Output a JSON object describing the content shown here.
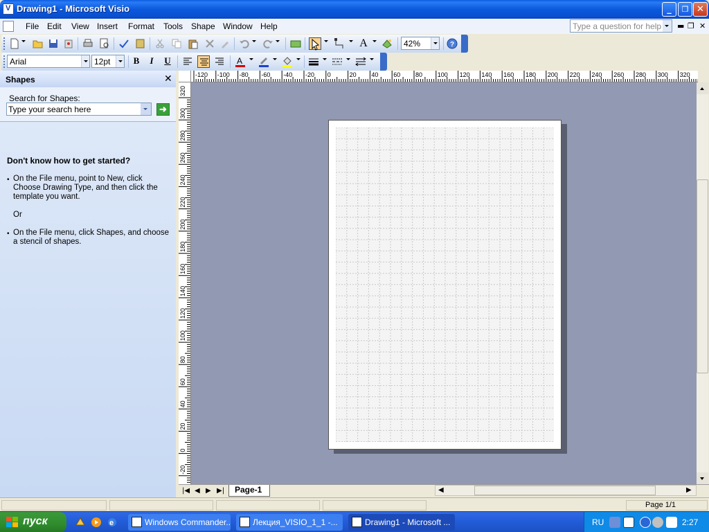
{
  "window": {
    "title": "Drawing1 - Microsoft Visio"
  },
  "menu": {
    "items": [
      {
        "label": "File"
      },
      {
        "label": "Edit"
      },
      {
        "label": "View"
      },
      {
        "label": "Insert"
      },
      {
        "label": "Format"
      },
      {
        "label": "Tools"
      },
      {
        "label": "Shape"
      },
      {
        "label": "Window"
      },
      {
        "label": "Help"
      }
    ],
    "help_placeholder": "Type a question for help"
  },
  "toolbar": {
    "zoom_value": "42%",
    "font_name": "Arial",
    "font_size": "12pt",
    "bold_label": "B",
    "italic_label": "I",
    "underline_label": "U",
    "text_tool_label": "A",
    "font_color": "#d40000",
    "line_color": "#1b3fd1",
    "fill_color": "#ffff00"
  },
  "task_pane": {
    "title": "Shapes",
    "search_label": "Search for Shapes:",
    "search_value": "Type your search here",
    "heading": "Don't know how to get started?",
    "paragraphs": [
      "On the File menu, point to New, click Choose Drawing Type, and then click the template you want.",
      "Or",
      "On the File menu, click Shapes, and choose a stencil of shapes."
    ]
  },
  "rulers": {
    "horizontal_labels": [
      "-120",
      "-100",
      "-80",
      "-60",
      "-40",
      "-20",
      "0",
      "20",
      "40",
      "60",
      "80",
      "100",
      "120",
      "140",
      "160",
      "180",
      "200",
      "220",
      "240",
      "260",
      "280",
      "300",
      "320"
    ],
    "vertical_labels": [
      "320",
      "300",
      "280",
      "260",
      "240",
      "220",
      "200",
      "180",
      "160",
      "140",
      "120",
      "100",
      "80",
      "60",
      "40",
      "20",
      "0",
      "-20"
    ]
  },
  "page_tabs": {
    "active": "Page-1"
  },
  "status_bar": {
    "page": "Page 1/1"
  },
  "taskbar": {
    "start_label": "пуск",
    "items": [
      {
        "label": "Windows Commander..."
      },
      {
        "label": "Лекция_VISIO_1_1 -..."
      },
      {
        "label": "Drawing1 - Microsoft ..."
      }
    ],
    "language": "RU",
    "clock": "2:27"
  },
  "colors": {
    "title_bar": "#0a58dd",
    "canvas_bg": "#9299b2",
    "start_button": "#2f8c2d"
  }
}
